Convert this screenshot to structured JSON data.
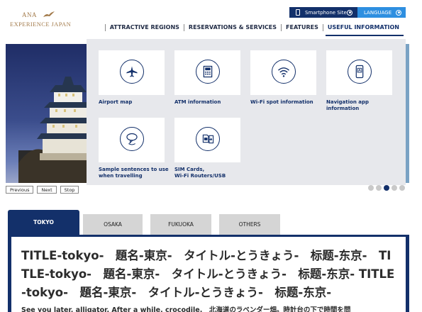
{
  "brand": {
    "logo_line1": "ANA",
    "logo_line2": "EXPERIENCE JAPAN",
    "accent": "#13306a",
    "logo_color": "#a27a4a"
  },
  "utility": {
    "smartphone_label": "Smartphone Site",
    "language_label": "LANGUAGE"
  },
  "nav": {
    "items": [
      {
        "label": "ATTRACTIVE REGIONS"
      },
      {
        "label": "RESERVATIONS & SERVICES"
      },
      {
        "label": "FEATURES"
      },
      {
        "label": "USEFUL INFORMATION"
      }
    ]
  },
  "dropdown": {
    "cards": [
      {
        "label": "Airport map",
        "icon": "airplane-icon"
      },
      {
        "label": "ATM information",
        "icon": "atm-icon"
      },
      {
        "label": "Wi-Fi spot information",
        "icon": "wifi-icon"
      },
      {
        "label": "Navigation app\ninformation",
        "icon": "navigation-app-icon"
      },
      {
        "label": "Sample sentences to use\nwhen travelling",
        "icon": "speech-bubble-icon"
      },
      {
        "label": "SIM Cards,\nWi-Fi Routers/USB",
        "icon": "sim-card-icon"
      }
    ]
  },
  "slider": {
    "previous_label": "Previous",
    "next_label": "Next",
    "stop_label": "Stop",
    "active_dot": 3
  },
  "tabs": [
    {
      "label": "TOKYO"
    },
    {
      "label": "OSAKA"
    },
    {
      "label": "FUKUOKA"
    },
    {
      "label": "OTHERS"
    }
  ],
  "content": {
    "title": "TITLE-tokyo-　題名-東京-　タイトル-とうきょう-　标题-东京-　TITLE-tokyo-　題名-東京-　タイトル-とうきょう-　标题-东京- TITLE-tokyo-　題名-東京-　タイトル-とうきょう-　标题-东京-",
    "body": "See you later, alligator. After a while, crocodile.　北海道のラベンダー畑。時計台の下で時間を問"
  }
}
